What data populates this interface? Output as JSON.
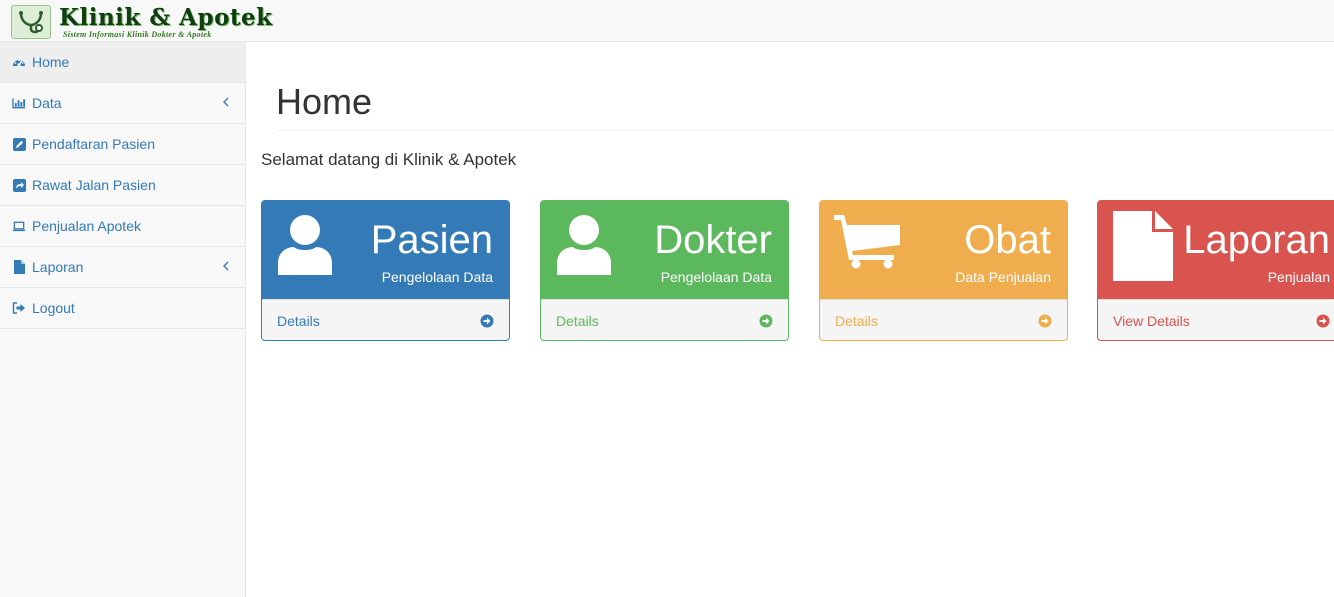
{
  "brand": {
    "title": "Klinik & Apotek",
    "subtitle": "Sistem Informasi Klinik Dokter & Apotek",
    "logo_icon": "stethoscope-icon"
  },
  "sidebar": {
    "items": [
      {
        "label": "Home",
        "icon": "dashboard-icon",
        "active": true
      },
      {
        "label": "Data",
        "icon": "bar-chart-icon",
        "has_caret": true
      },
      {
        "label": "Pendaftaran Pasien",
        "icon": "edit-icon"
      },
      {
        "label": "Rawat Jalan Pasien",
        "icon": "share-icon"
      },
      {
        "label": "Penjualan Apotek",
        "icon": "laptop-icon"
      },
      {
        "label": "Laporan",
        "icon": "file-icon",
        "has_caret": true
      },
      {
        "label": "Logout",
        "icon": "sign-out-icon"
      }
    ]
  },
  "main": {
    "title": "Home",
    "welcome": "Selamat datang di Klinik & Apotek",
    "panels": [
      {
        "title": "Pasien",
        "subtitle": "Pengelolaan Data",
        "footer": "Details",
        "icon": "user-icon",
        "color": "#337ab7"
      },
      {
        "title": "Dokter",
        "subtitle": "Pengelolaan Data",
        "footer": "Details",
        "icon": "user-icon",
        "color": "#5cb85c"
      },
      {
        "title": "Obat",
        "subtitle": "Data Penjualan",
        "footer": "Details",
        "icon": "shopping-cart-icon",
        "color": "#f0ad4e"
      },
      {
        "title": "Laporan",
        "subtitle": "Penjualan",
        "footer": "View Details",
        "icon": "file-icon",
        "color": "#d9534f"
      }
    ]
  }
}
